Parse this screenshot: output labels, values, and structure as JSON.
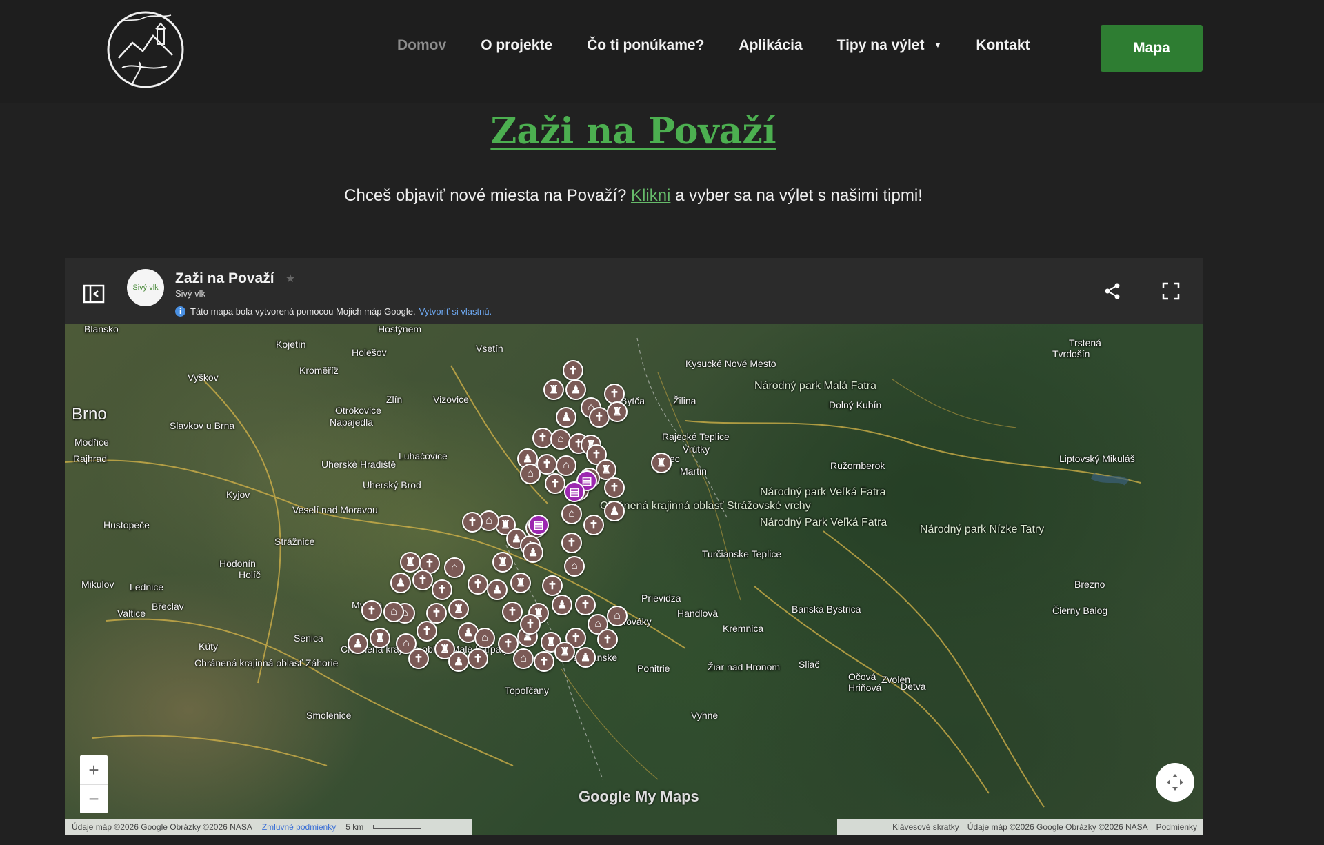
{
  "header": {
    "nav": [
      {
        "label": "Domov",
        "active": true
      },
      {
        "label": "O projekte"
      },
      {
        "label": "Čo ti ponúkame?"
      },
      {
        "label": "Aplikácia"
      },
      {
        "label": "Tipy na výlet",
        "dropdown": true
      },
      {
        "label": "Kontakt"
      }
    ],
    "cta_label": "Mapa"
  },
  "page": {
    "title": "Zaži na Považí",
    "subtitle_before": "Chceš objaviť nové miesta na Považí?",
    "subtitle_link": "Klikni",
    "subtitle_after": "a vyber sa na výlet s našimi tipmi!"
  },
  "map_embed": {
    "title": "Zaži na Považí",
    "author": "Sivý vlk",
    "avatar_text": "Sivý vlk",
    "info_text": "Táto mapa bola vytvorená pomocou Mojich máp Google.",
    "info_link": "Vytvoriť si vlastnú.",
    "watermark": "Google My Maps",
    "footer_left": "Údaje máp ©2026 Google Obrázky ©2026 NASA",
    "footer_left_link": "Zmluvné podmienky",
    "scale": "5 km",
    "footer_right_shortcuts": "Klávesové skratky",
    "footer_right_data": "Údaje máp ©2026 Google Obrázky ©2026 NASA",
    "footer_right_terms": "Podmienky",
    "places": [
      "Blansko",
      "Kojetín",
      "Holešov",
      "Hostýnem",
      "Vsetín",
      "Trstená",
      "Tvrdošín",
      "Vyškov",
      "Kroměříž",
      "Kysucké Nové Mesto",
      "Národný park Malá Fatra",
      "Brno",
      "Slavkov u Brna",
      "Zlín",
      "Vizovice",
      "Bytča",
      "Žilina",
      "Dolný Kubín",
      "Otrokovice",
      "Napajedla",
      "Rajecké Teplice",
      "Rajec",
      "Modřice",
      "Rajhrad",
      "Uherské Hradiště",
      "Luhačovice",
      "Vrútky",
      "Martin",
      "Ružomberok",
      "Liptovský Mikuláš",
      "Uherský Brod",
      "Kyjov",
      "Národný park Veľká Fatra",
      "Hustopeče",
      "Veselí nad Moravou",
      "Národný Park Veľká Fatra",
      "Národný park Nízke Tatry",
      "Strážnice",
      "Hodonín",
      "Turčianske Teplice",
      "Mikulov",
      "Lednice",
      "Holíč",
      "Prievidza",
      "Brezno",
      "Valtice",
      "Břeclav",
      "Myjava",
      "Handlová",
      "Banská Bystrica",
      "Čierny Balog",
      "Nováky",
      "Kremnica",
      "Senica",
      "Kúty",
      "Chránená krajinná oblasť Záhorie",
      "Chránená krajinná oblasť Malé Karpaty",
      "Partizánske",
      "Ponitrie",
      "Žiar nad Hronom",
      "Sliač",
      "Očová",
      "Hriňová",
      "Zvolen",
      "Detva",
      "Topoľčany",
      "Smolenice",
      "Vyhne",
      "Chránená krajinná oblasť Strážovské vrchy"
    ]
  }
}
